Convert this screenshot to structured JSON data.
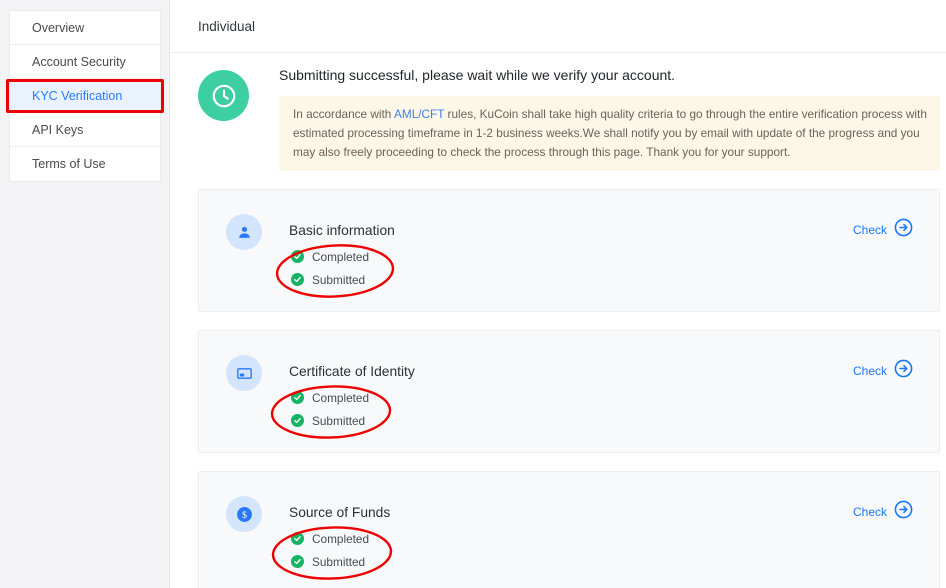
{
  "sidebar": {
    "items": [
      {
        "label": "Overview",
        "active": false
      },
      {
        "label": "Account Security",
        "active": false
      },
      {
        "label": "KYC Verification",
        "active": true
      },
      {
        "label": "API Keys",
        "active": false
      },
      {
        "label": "Terms of Use",
        "active": false
      }
    ]
  },
  "header": {
    "tab_label": "Individual"
  },
  "status": {
    "icon": "clock-icon",
    "icon_color": "#3dcfa2",
    "title": "Submitting successful, please wait while we verify your account.",
    "notice": {
      "background": "#fdf7e8",
      "part1": "In accordance with ",
      "link": "AML/CFT",
      "part2": " rules, KuCoin shall take high quality criteria to go through the entire verification process with estimated processing timeframe in 1-2 business weeks.We shall notify you by email with update of the progress and you may also freely proceeding to check the process through this page. Thank you for your support."
    }
  },
  "cards": [
    {
      "icon": "person-icon",
      "title": "Basic information",
      "statuses": [
        "Completed",
        "Submitted"
      ],
      "action_label": "Check",
      "action_icon": "arrow-right-circle-icon"
    },
    {
      "icon": "id-card-icon",
      "title": "Certificate of Identity",
      "statuses": [
        "Completed",
        "Submitted"
      ],
      "action_label": "Check",
      "action_icon": "arrow-right-circle-icon"
    },
    {
      "icon": "dollar-circle-icon",
      "title": "Source of Funds",
      "statuses": [
        "Completed",
        "Submitted"
      ],
      "action_label": "Check",
      "action_icon": "arrow-right-circle-icon"
    }
  ],
  "annotations": {
    "color": "#ee0000",
    "rect_target": "KYC Verification",
    "ellipse_targets": [
      "Basic information statuses",
      "Certificate of Identity statuses",
      "Source of Funds statuses"
    ]
  },
  "colors": {
    "accent_blue": "#1677ff",
    "link_blue": "#3f7fe8",
    "success_green": "#16b364",
    "pending_teal": "#3dcfa2",
    "annotation_red": "#ee0000",
    "card_bg": "#f8f9fb",
    "notice_bg": "#fdf7e8"
  }
}
